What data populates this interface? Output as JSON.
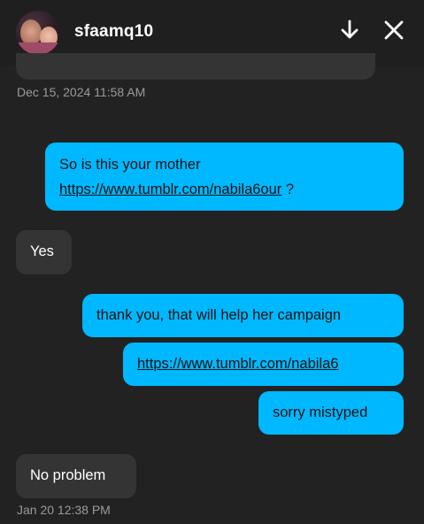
{
  "header": {
    "username": "sfaamq10",
    "avatar_icon": "user-avatar-photo",
    "down_icon": "arrow-down-icon",
    "close_icon": "close-icon"
  },
  "timestamps": {
    "first": "Dec 15, 2024 11:58 AM",
    "last": "Jan 20 12:38 PM"
  },
  "messages": [
    {
      "from": "me",
      "text_before": "So is this your mother",
      "link": "https://www.tumblr.com/nabila6our",
      "text_after": " ?"
    },
    {
      "from": "them",
      "text": "Yes"
    },
    {
      "from": "me",
      "text": "thank you, that will help her campaign"
    },
    {
      "from": "me",
      "link": "https://www.tumblr.com/nabila6"
    },
    {
      "from": "me",
      "text": "sorry mistyped"
    },
    {
      "from": "them",
      "text": "No problem"
    }
  ],
  "colors": {
    "background": "#222222",
    "sent_bubble": "#00b8ff",
    "received_bubble": "#343434",
    "timestamp_text": "#9a9a9a"
  }
}
